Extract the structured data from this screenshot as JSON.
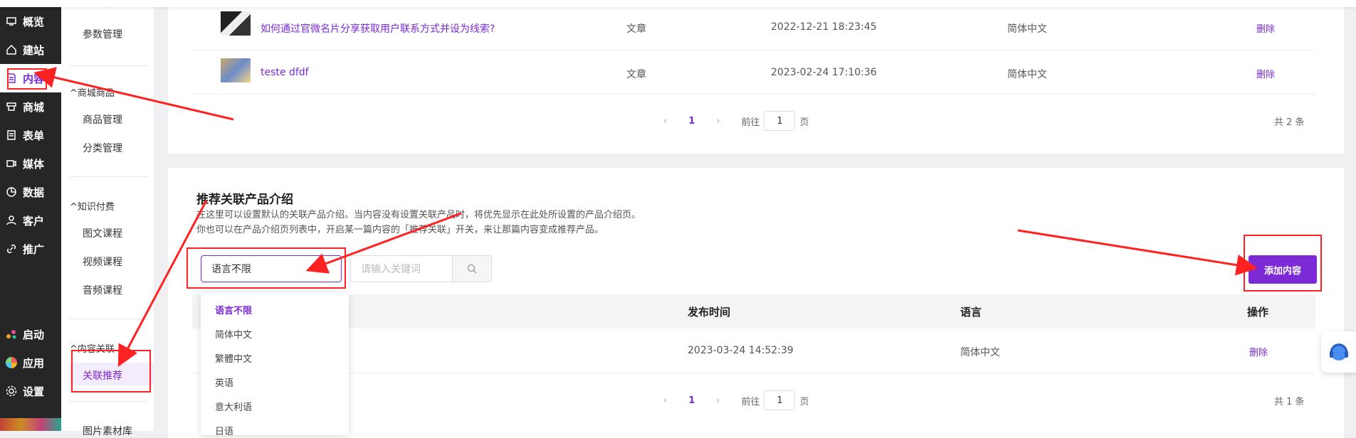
{
  "rail": {
    "items": [
      {
        "label": "概览",
        "icon": "dashboard-icon"
      },
      {
        "label": "建站",
        "icon": "home-icon"
      },
      {
        "label": "内容",
        "icon": "document-icon"
      },
      {
        "label": "商城",
        "icon": "shop-icon"
      },
      {
        "label": "表单",
        "icon": "form-icon"
      },
      {
        "label": "媒体",
        "icon": "media-icon"
      },
      {
        "label": "数据",
        "icon": "chart-icon"
      },
      {
        "label": "客户",
        "icon": "user-icon"
      },
      {
        "label": "推广",
        "icon": "link-icon"
      },
      {
        "label": "启动",
        "icon": "dots-icon"
      },
      {
        "label": "应用",
        "icon": "apps-icon"
      },
      {
        "label": "设置",
        "icon": "gear-icon"
      }
    ]
  },
  "subnav": {
    "top_partial": "分类管理",
    "param": "参数管理",
    "shop_group": "商城商品",
    "shop_items": [
      "商品管理",
      "分类管理"
    ],
    "knowledge_group": "知识付费",
    "knowledge_items": [
      "图文课程",
      "视频课程",
      "音频课程"
    ],
    "related_group": "内容关联",
    "related_item": "关联推荐",
    "bottom_partial": "图片素材库"
  },
  "top_table": {
    "rows": [
      {
        "title": "如何通过官微名片分享获取用户联系方式并设为线索?",
        "type": "文章",
        "time": "2022-12-21 18:23:45",
        "lang": "简体中文",
        "action": "删除"
      },
      {
        "title": "teste dfdf",
        "type": "文章",
        "time": "2023-02-24 17:10:36",
        "lang": "简体中文",
        "action": "删除"
      }
    ],
    "pager": {
      "current": "1",
      "goto": "前往",
      "page_value": "1",
      "page_unit": "页",
      "total": "共 2 条"
    }
  },
  "section": {
    "title": "推荐关联产品介绍",
    "desc1": "在这里可以设置默认的关联产品介绍。当内容没有设置关联产品时，将优先显示在此处所设置的产品介绍页。",
    "desc2": "你也可以在产品介绍页列表中，开启某一篇内容的「推荐关联」开关，来让那篇内容变成推荐产品。",
    "select_value": "语言不限",
    "search_placeholder": "请输入关键词",
    "add_button": "添加内容",
    "headers": {
      "time": "发布时间",
      "lang": "语言",
      "action": "操作"
    },
    "row": {
      "time": "2023-03-24 14:52:39",
      "lang": "简体中文",
      "action": "删除"
    },
    "pager": {
      "current": "1",
      "goto": "前往",
      "page_value": "1",
      "page_unit": "页",
      "total": "共 1 条"
    },
    "dropdown": [
      "语言不限",
      "简体中文",
      "繁體中文",
      "英语",
      "意大利语",
      "日语"
    ]
  },
  "colors": {
    "accent": "#7c2ad6",
    "annotation": "#ff2222",
    "rail_bg": "#262626"
  }
}
